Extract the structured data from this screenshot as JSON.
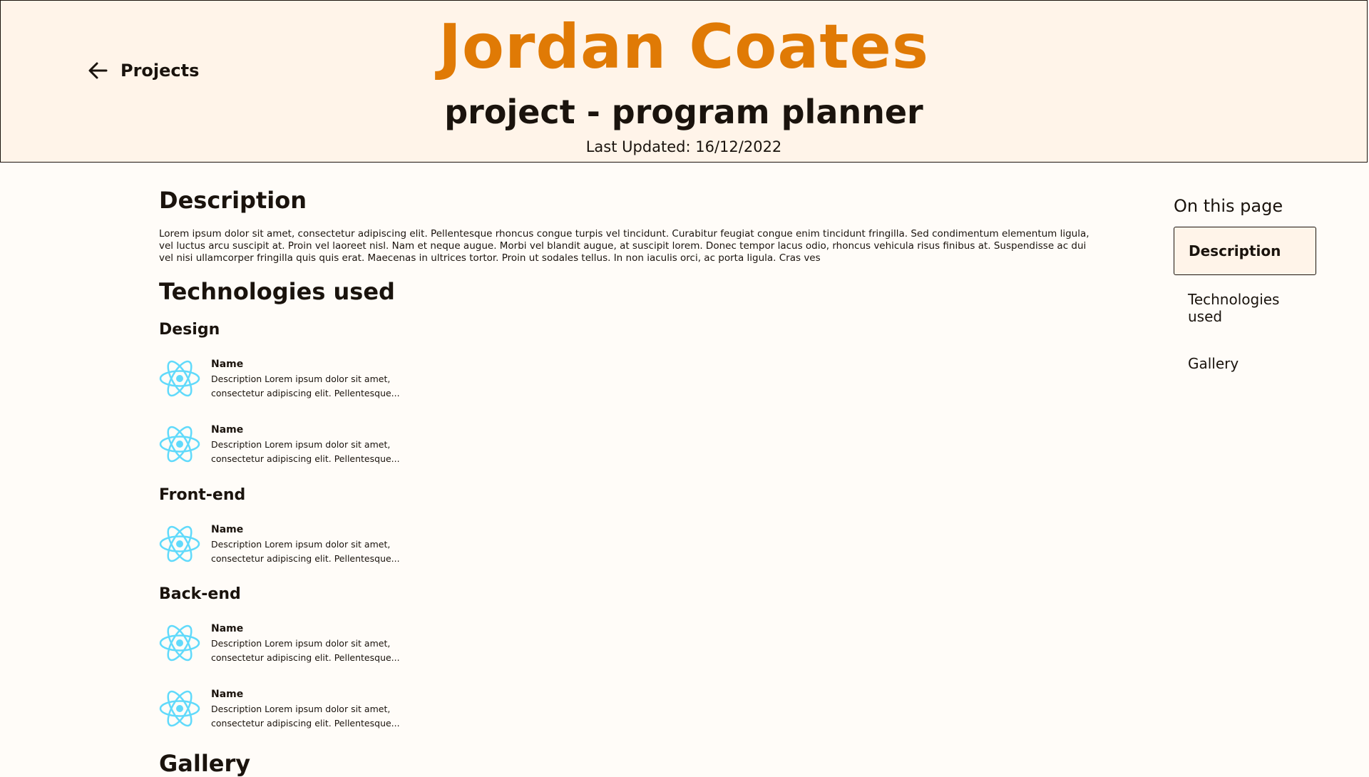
{
  "header": {
    "back_label": "Projects",
    "site_name": "Jordan Coates",
    "project_title": "project - program planner",
    "last_updated": "Last Updated: 16/12/2022"
  },
  "description": {
    "title": "Description",
    "text": "Lorem ipsum dolor sit amet, consectetur adipiscing elit. Pellentesque rhoncus congue turpis vel tincidunt. Curabitur feugiat congue enim tincidunt fringilla. Sed condimentum elementum ligula, vel luctus arcu suscipit at. Proin vel laoreet nisl. Nam et neque augue. Morbi vel blandit augue, at suscipit lorem. Donec tempor lacus odio, rhoncus vehicula risus finibus at. Suspendisse ac dui vel nisi ullamcorper fringilla quis quis erat. Maecenas in ultrices tortor. Proin ut sodales tellus. In non iaculis orci, ac porta ligula. Cras ves"
  },
  "technologies": {
    "title": "Technologies used",
    "groups": [
      {
        "heading": "Design",
        "items": [
          {
            "icon": "react-icon",
            "name": "Name",
            "text": "Description Lorem ipsum dolor sit amet, consectetur adipiscing elit. Pellentesque..."
          },
          {
            "icon": "react-icon",
            "name": "Name",
            "text": "Description Lorem ipsum dolor sit amet, consectetur adipiscing elit. Pellentesque..."
          }
        ]
      },
      {
        "heading": "Front-end",
        "items": [
          {
            "icon": "react-icon",
            "name": "Name",
            "text": "Description Lorem ipsum dolor sit amet, consectetur adipiscing elit. Pellentesque..."
          }
        ]
      },
      {
        "heading": "Back-end",
        "items": [
          {
            "icon": "react-icon",
            "name": "Name",
            "text": "Description Lorem ipsum dolor sit amet, consectetur adipiscing elit. Pellentesque..."
          },
          {
            "icon": "react-icon",
            "name": "Name",
            "text": "Description Lorem ipsum dolor sit amet, consectetur adipiscing elit. Pellentesque..."
          }
        ]
      }
    ]
  },
  "gallery": {
    "title": "Gallery"
  },
  "toc": {
    "heading": "On this page",
    "items": [
      {
        "label": "Description",
        "active": true
      },
      {
        "label": "Technologies used",
        "active": false
      },
      {
        "label": "Gallery",
        "active": false
      }
    ]
  },
  "colors": {
    "accent": "#e07a05",
    "header_bg": "#fff4e9",
    "page_bg": "#fffcf8",
    "text": "#1a130d",
    "icon": "#61dafb"
  }
}
